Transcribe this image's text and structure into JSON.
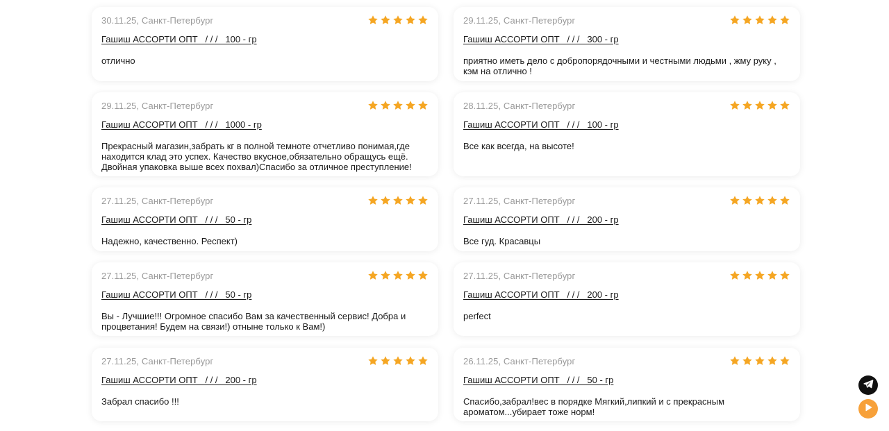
{
  "colors": {
    "star": "#F5A623",
    "meta": "#9A9A9A",
    "telegram_bg": "#111111",
    "play_bg": "#F7A13A"
  },
  "reviews": [
    {
      "date": "30.11.25, Санкт-Петербург",
      "rating": 5,
      "product": "Гашиш АССОРТИ ОПТ   / / /   100 - гр",
      "text": "отлично"
    },
    {
      "date": "29.11.25, Санкт-Петербург",
      "rating": 5,
      "product": "Гашиш АССОРТИ ОПТ   / / /   300 - гр",
      "text": "приятно иметь дело с добропорядочными и честными людьми , жму руку , кэм на отлично !"
    },
    {
      "date": "29.11.25, Санкт-Петербург",
      "rating": 5,
      "product": "Гашиш АССОРТИ ОПТ   / / /   1000 - гр",
      "text": "Прекрасный магазин,забрать кг в полной темноте отчетливо понимая,где находится клад это успех. Качество вкусное,обязательно обращусь ещё. Двойная упаковка выше всех похвал)Спасибо за отличное преступление!"
    },
    {
      "date": "28.11.25, Санкт-Петербург",
      "rating": 5,
      "product": "Гашиш АССОРТИ ОПТ   / / /   100 - гр",
      "text": "Все как всегда, на высоте!"
    },
    {
      "date": "27.11.25, Санкт-Петербург",
      "rating": 5,
      "product": "Гашиш АССОРТИ ОПТ   / / /   50 - гр",
      "text": "Надежно, качественно. Респект)"
    },
    {
      "date": "27.11.25, Санкт-Петербург",
      "rating": 5,
      "product": "Гашиш АССОРТИ ОПТ   / / /   200 - гр",
      "text": "Все гуд. Красавцы"
    },
    {
      "date": "27.11.25, Санкт-Петербург",
      "rating": 5,
      "product": "Гашиш АССОРТИ ОПТ   / / /   50 - гр",
      "text": "Вы - Лучшие!!! Огромное спасибо Вам за качественный сервис! Добра и процветания! Будем на связи!) отныне только к Вам!)"
    },
    {
      "date": "27.11.25, Санкт-Петербург",
      "rating": 5,
      "product": "Гашиш АССОРТИ ОПТ   / / /   200 - гр",
      "text": "perfect"
    },
    {
      "date": "27.11.25, Санкт-Петербург",
      "rating": 5,
      "product": "Гашиш АССОРТИ ОПТ   / / /   200 - гр",
      "text": "Забрал спасибо !!!"
    },
    {
      "date": "26.11.25, Санкт-Петербург",
      "rating": 5,
      "product": "Гашиш АССОРТИ ОПТ   / / /   50 - гр",
      "text": "Спасибо,забрал!вес в порядке Мягкий,липкий и с прекрасным ароматом...убирает тоже норм!"
    }
  ],
  "floating": {
    "telegram_icon": "telegram-icon",
    "play_icon": "play-icon"
  }
}
